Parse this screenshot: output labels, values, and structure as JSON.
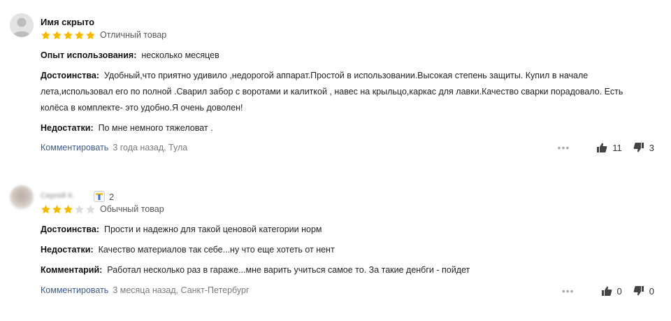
{
  "reviews": [
    {
      "author": "Имя скрыто",
      "stars": 5,
      "rating_label": "Отличный товар",
      "fields": [
        {
          "label": "Опыт использования:",
          "text": "несколько месяцев"
        },
        {
          "label": "Достоинства:",
          "text": "Удобный,что приятно удивило ,недорогой аппарат.Простой в использовании.Высокая степень защиты. Купил в начале лета,использовал его по полной .Сварил забор с воротами и калиткой , навес на крыльцо,каркас для лавки.Качество сварки порадовало. Есть колёса в комплекте- это удобно.Я очень доволен!"
        },
        {
          "label": "Недостатки:",
          "text": "По мне немного тяжеловат ."
        }
      ],
      "comment_link": "Комментировать",
      "meta": "3 года назад, Тула",
      "likes": "11",
      "dislikes": "3"
    },
    {
      "author": "Сергей К.",
      "badge_count": "2",
      "stars": 3,
      "rating_label": "Обычный товар",
      "fields": [
        {
          "label": "Достоинства:",
          "text": "Прости и надежно для такой ценовой категории норм"
        },
        {
          "label": "Недостатки:",
          "text": "Качество материалов так себе...ну что еще хотеть от нент"
        },
        {
          "label": "Комментарий:",
          "text": "Работал несколько раз в гараже...мне варить учиться самое то. За такие денбги - пойдет"
        }
      ],
      "comment_link": "Комментировать",
      "meta": "3 месяца назад, Санкт-Петербург",
      "likes": "0",
      "dislikes": "0"
    }
  ],
  "colors": {
    "star_filled": "#f5b800",
    "star_empty": "#dcdcdc",
    "link": "#3b5a8f"
  },
  "icons": [
    "user-avatar-icon",
    "star-icon",
    "more-dots-icon",
    "thumb-up-icon",
    "thumb-down-icon",
    "badge-icon"
  ]
}
